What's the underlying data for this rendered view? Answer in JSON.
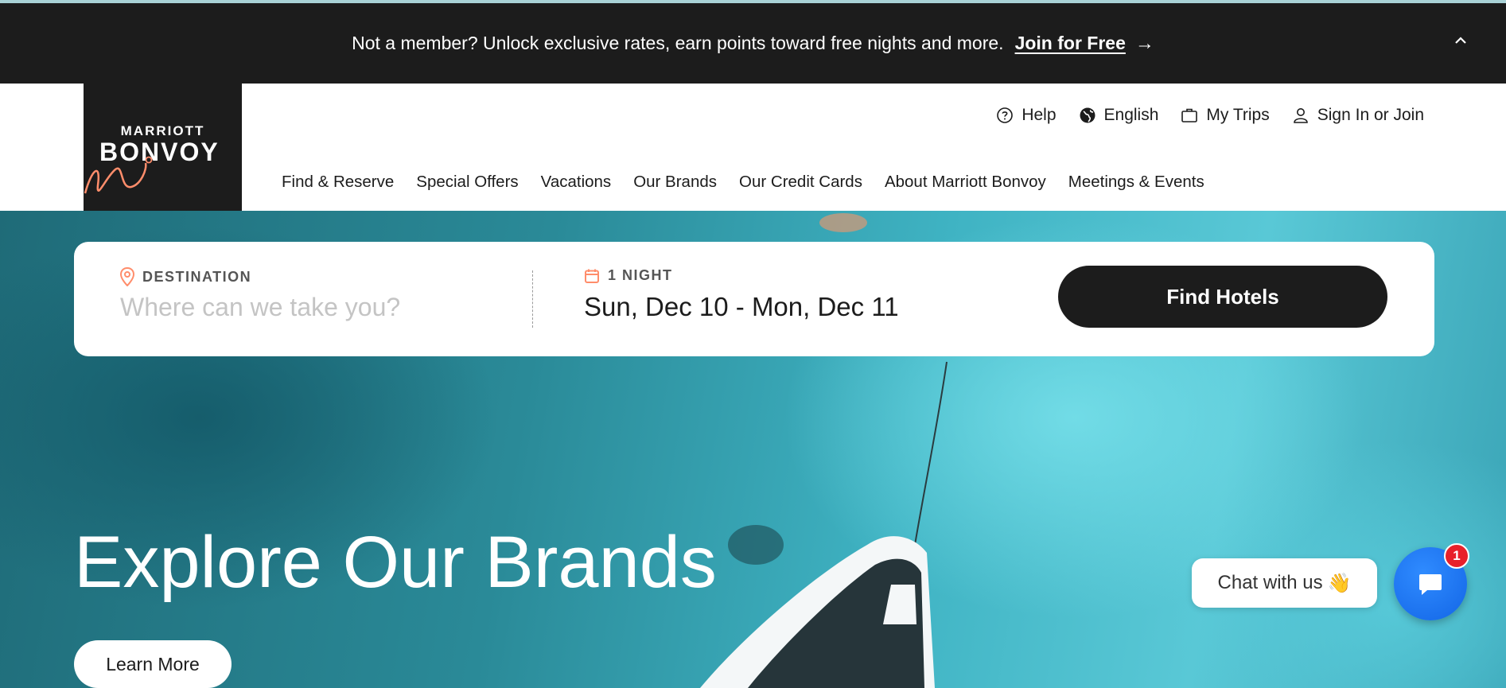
{
  "promo": {
    "message": "Not a member? Unlock exclusive rates, earn points toward free nights and more.",
    "join_label": "Join for Free",
    "arrow_icon": "arrow-right-icon",
    "collapse_icon": "chevron-up-icon"
  },
  "logo": {
    "line1": "MARRIOTT",
    "line2": "BONVOY"
  },
  "utility_nav": [
    {
      "label": "Help",
      "icon": "help-circle-icon"
    },
    {
      "label": "English",
      "icon": "globe-icon"
    },
    {
      "label": "My Trips",
      "icon": "briefcase-icon"
    },
    {
      "label": "Sign In or Join",
      "icon": "user-icon"
    }
  ],
  "main_nav": [
    "Find & Reserve",
    "Special Offers",
    "Vacations",
    "Our Brands",
    "Our Credit Cards",
    "About Marriott Bonvoy",
    "Meetings & Events"
  ],
  "search": {
    "destination_label": "DESTINATION",
    "destination_placeholder": "Where can we take you?",
    "nights_label": "1 NIGHT",
    "dates_value": "Sun, Dec 10 - Mon, Dec 11",
    "find_button": "Find Hotels"
  },
  "hero": {
    "title": "Explore Our Brands",
    "cta": "Learn More"
  },
  "chat": {
    "pill_label": "Chat with us",
    "pill_emoji": "👋",
    "badge_count": "1"
  },
  "colors": {
    "promo_bg": "#1c1c1c",
    "accent_orange": "#ff8d6b",
    "chat_blue": "#1f76f0",
    "badge_red": "#e8202a"
  }
}
